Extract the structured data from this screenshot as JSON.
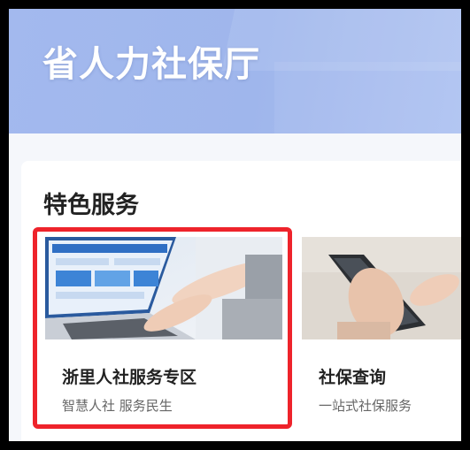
{
  "header": {
    "title": "省人力社保厅"
  },
  "section": {
    "title": "特色服务"
  },
  "cards": [
    {
      "title": "浙里人社服务专区",
      "subtitle": "智慧人社 服务民生",
      "image_icon": "laptop-typing-image"
    },
    {
      "title": "社保查询",
      "subtitle": "一站式社保服务",
      "image_icon": "phone-hand-image"
    }
  ],
  "colors": {
    "header_bg": "#a3b9ee",
    "highlight_border": "#ee232b",
    "title_text": "#222222",
    "sub_text": "#666666"
  }
}
